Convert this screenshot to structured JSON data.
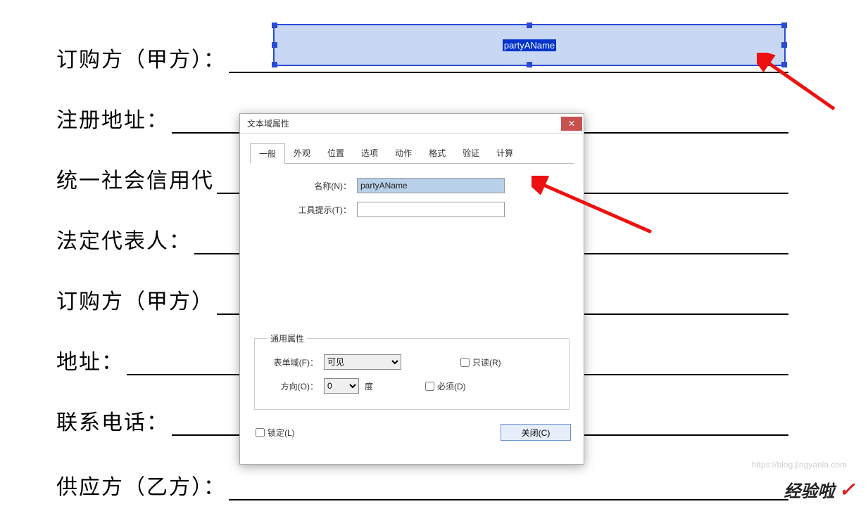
{
  "doc": {
    "labels": [
      "订购方（甲方）：",
      "注册地址：",
      "统一社会信用代",
      "法定代表人：",
      "订购方（甲方）",
      "地址：",
      "联系电话：",
      "供应方（乙方）："
    ],
    "field_placeholder": "partyAName"
  },
  "dialog": {
    "title": "文本域属性",
    "tabs": [
      "一般",
      "外观",
      "位置",
      "选项",
      "动作",
      "格式",
      "验证",
      "计算"
    ],
    "name_label": "名称(N)：",
    "name_value": "partyAName",
    "tooltip_label": "工具提示(T)：",
    "tooltip_value": "",
    "common_legend": "通用属性",
    "form_domain_label": "表单域(F)：",
    "form_domain_value": "可见",
    "direction_label": "方向(O)：",
    "direction_value": "0",
    "direction_unit": "度",
    "readonly_label": "只读(R)",
    "required_label": "必须(D)",
    "lock_label": "锁定(L)",
    "close_btn": "关闭(C)"
  },
  "watermark": {
    "url": "https://blog.jingyanla.com",
    "logo": "经验啦"
  }
}
